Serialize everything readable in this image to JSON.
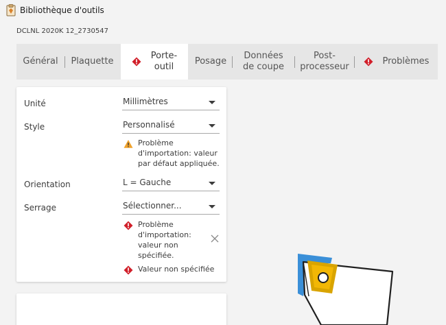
{
  "window": {
    "title": "Bibliothèque d'outils"
  },
  "subtitle": "DCLNL 2020K 12_2730547",
  "tabs": [
    {
      "label": "Général"
    },
    {
      "label": "Plaquette"
    },
    {
      "label": "Porte-\noutil",
      "error": true,
      "active": true
    },
    {
      "label": "Posage"
    },
    {
      "label": "Données\nde coupe"
    },
    {
      "label": "Post-\nprocesseur"
    },
    {
      "label": "Problèmes",
      "error": true
    }
  ],
  "form": {
    "unit": {
      "label": "Unité",
      "value": "Millimètres"
    },
    "style": {
      "label": "Style",
      "value": "Personnalisé",
      "warning": [
        "Problème",
        "d'importation: valeur",
        "par défaut appliquée."
      ]
    },
    "orientation": {
      "label": "Orientation",
      "value": "L = Gauche"
    },
    "clamping": {
      "label": "Serrage",
      "placeholder": "Sélectionner...",
      "error": [
        "Problème",
        "d'importation:",
        "valeur non",
        "spécifiée."
      ],
      "error2": "Valeur non spécifiée"
    }
  },
  "colors": {
    "error": "#d11f2a",
    "warning": "#f0a22b",
    "insert": "#f2b705",
    "accent_blue": "#3a8fd8"
  }
}
